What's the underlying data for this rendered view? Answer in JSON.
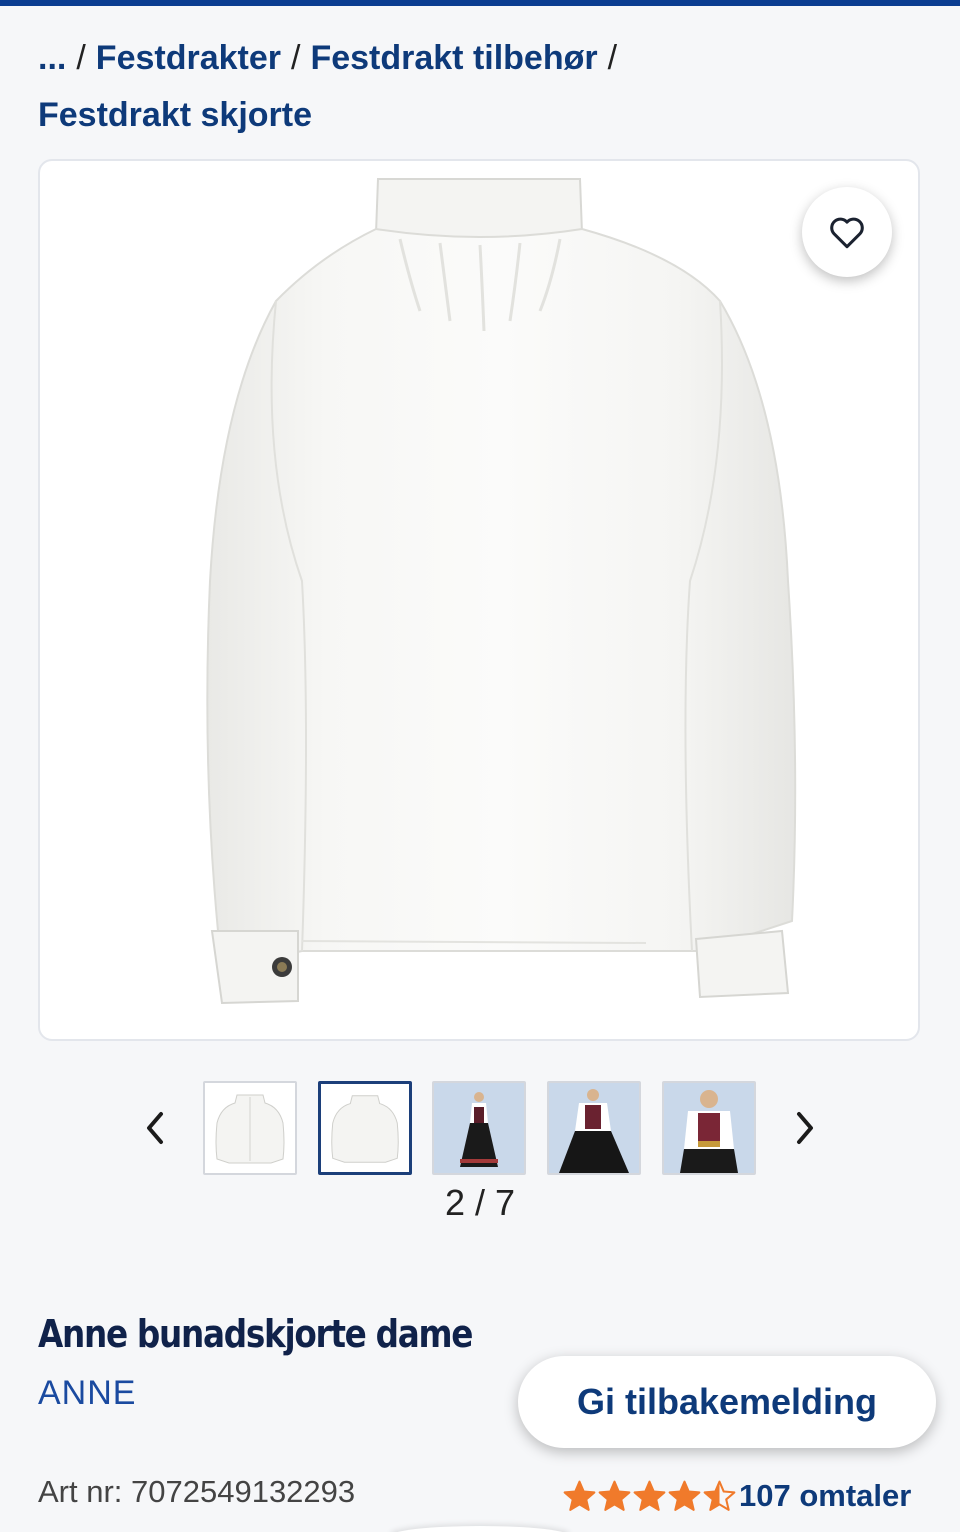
{
  "breadcrumb": {
    "ellipsis": "...",
    "separator": "/",
    "items": [
      "Festdrakter",
      "Festdrakt tilbehør",
      "Festdrakt skjorte"
    ]
  },
  "gallery": {
    "counter": "2 / 7",
    "current": 2,
    "total": 7
  },
  "product": {
    "title": "Anne bunadskjorte dame",
    "brand": "ANNE",
    "art_nr": "Art nr: 7072549132293",
    "rating": 4.5,
    "rating_max": 5,
    "reviews": "107 omtaler"
  },
  "feedback": {
    "label": "Gi tilbakemelding"
  },
  "colors": {
    "accent": "#0e3a7a",
    "star": "#f07a2b",
    "topbar": "#0b3d91"
  },
  "icons": {
    "favorite": "heart-icon",
    "prev": "chevron-left-icon",
    "next": "chevron-right-icon",
    "rating": "star-icon"
  }
}
